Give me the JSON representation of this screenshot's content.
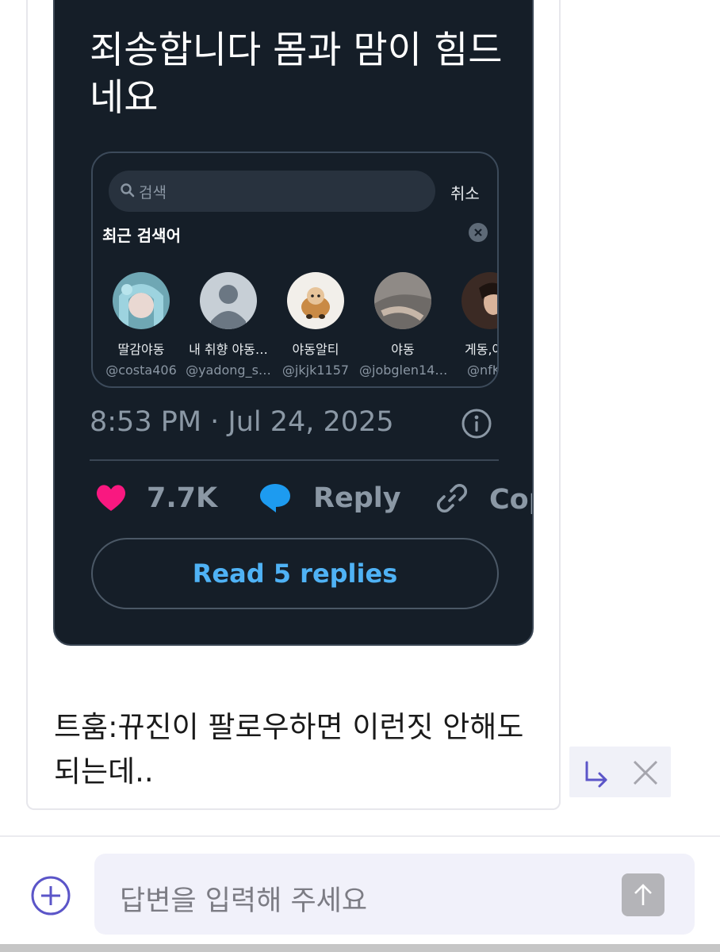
{
  "tweet": {
    "text": "죄송합니다 몸과 맘이 힘드네요",
    "timestamp": "8:53 PM · Jul 24, 2025",
    "likes": "7.7K",
    "reply_label": "Reply",
    "copy_label": "Cop",
    "read_replies_label": "Read 5 replies",
    "colors": {
      "background": "#151e28",
      "like": "#f91880",
      "reply": "#1d9bf0",
      "read_replies": "#4fb2f5"
    }
  },
  "search_panel": {
    "placeholder": "검색",
    "cancel_label": "취소",
    "recent_title": "최근 검색어",
    "accounts": [
      {
        "name": "딸감야동",
        "handle": "@costa406"
      },
      {
        "name": "내 취향 야동…",
        "handle": "@yadong_s…"
      },
      {
        "name": "야동알티",
        "handle": "@jkjk1157"
      },
      {
        "name": "야동",
        "handle": "@jobglen14…"
      },
      {
        "name": "게동,야동",
        "handle": "@nfKEf"
      }
    ]
  },
  "message": {
    "caption": "트훔:뀨진이 팔로우하면 이런짓 안해도 되는데.."
  },
  "composer": {
    "placeholder": "답변을 입력해 주세요",
    "accent": "#5b55c8"
  }
}
